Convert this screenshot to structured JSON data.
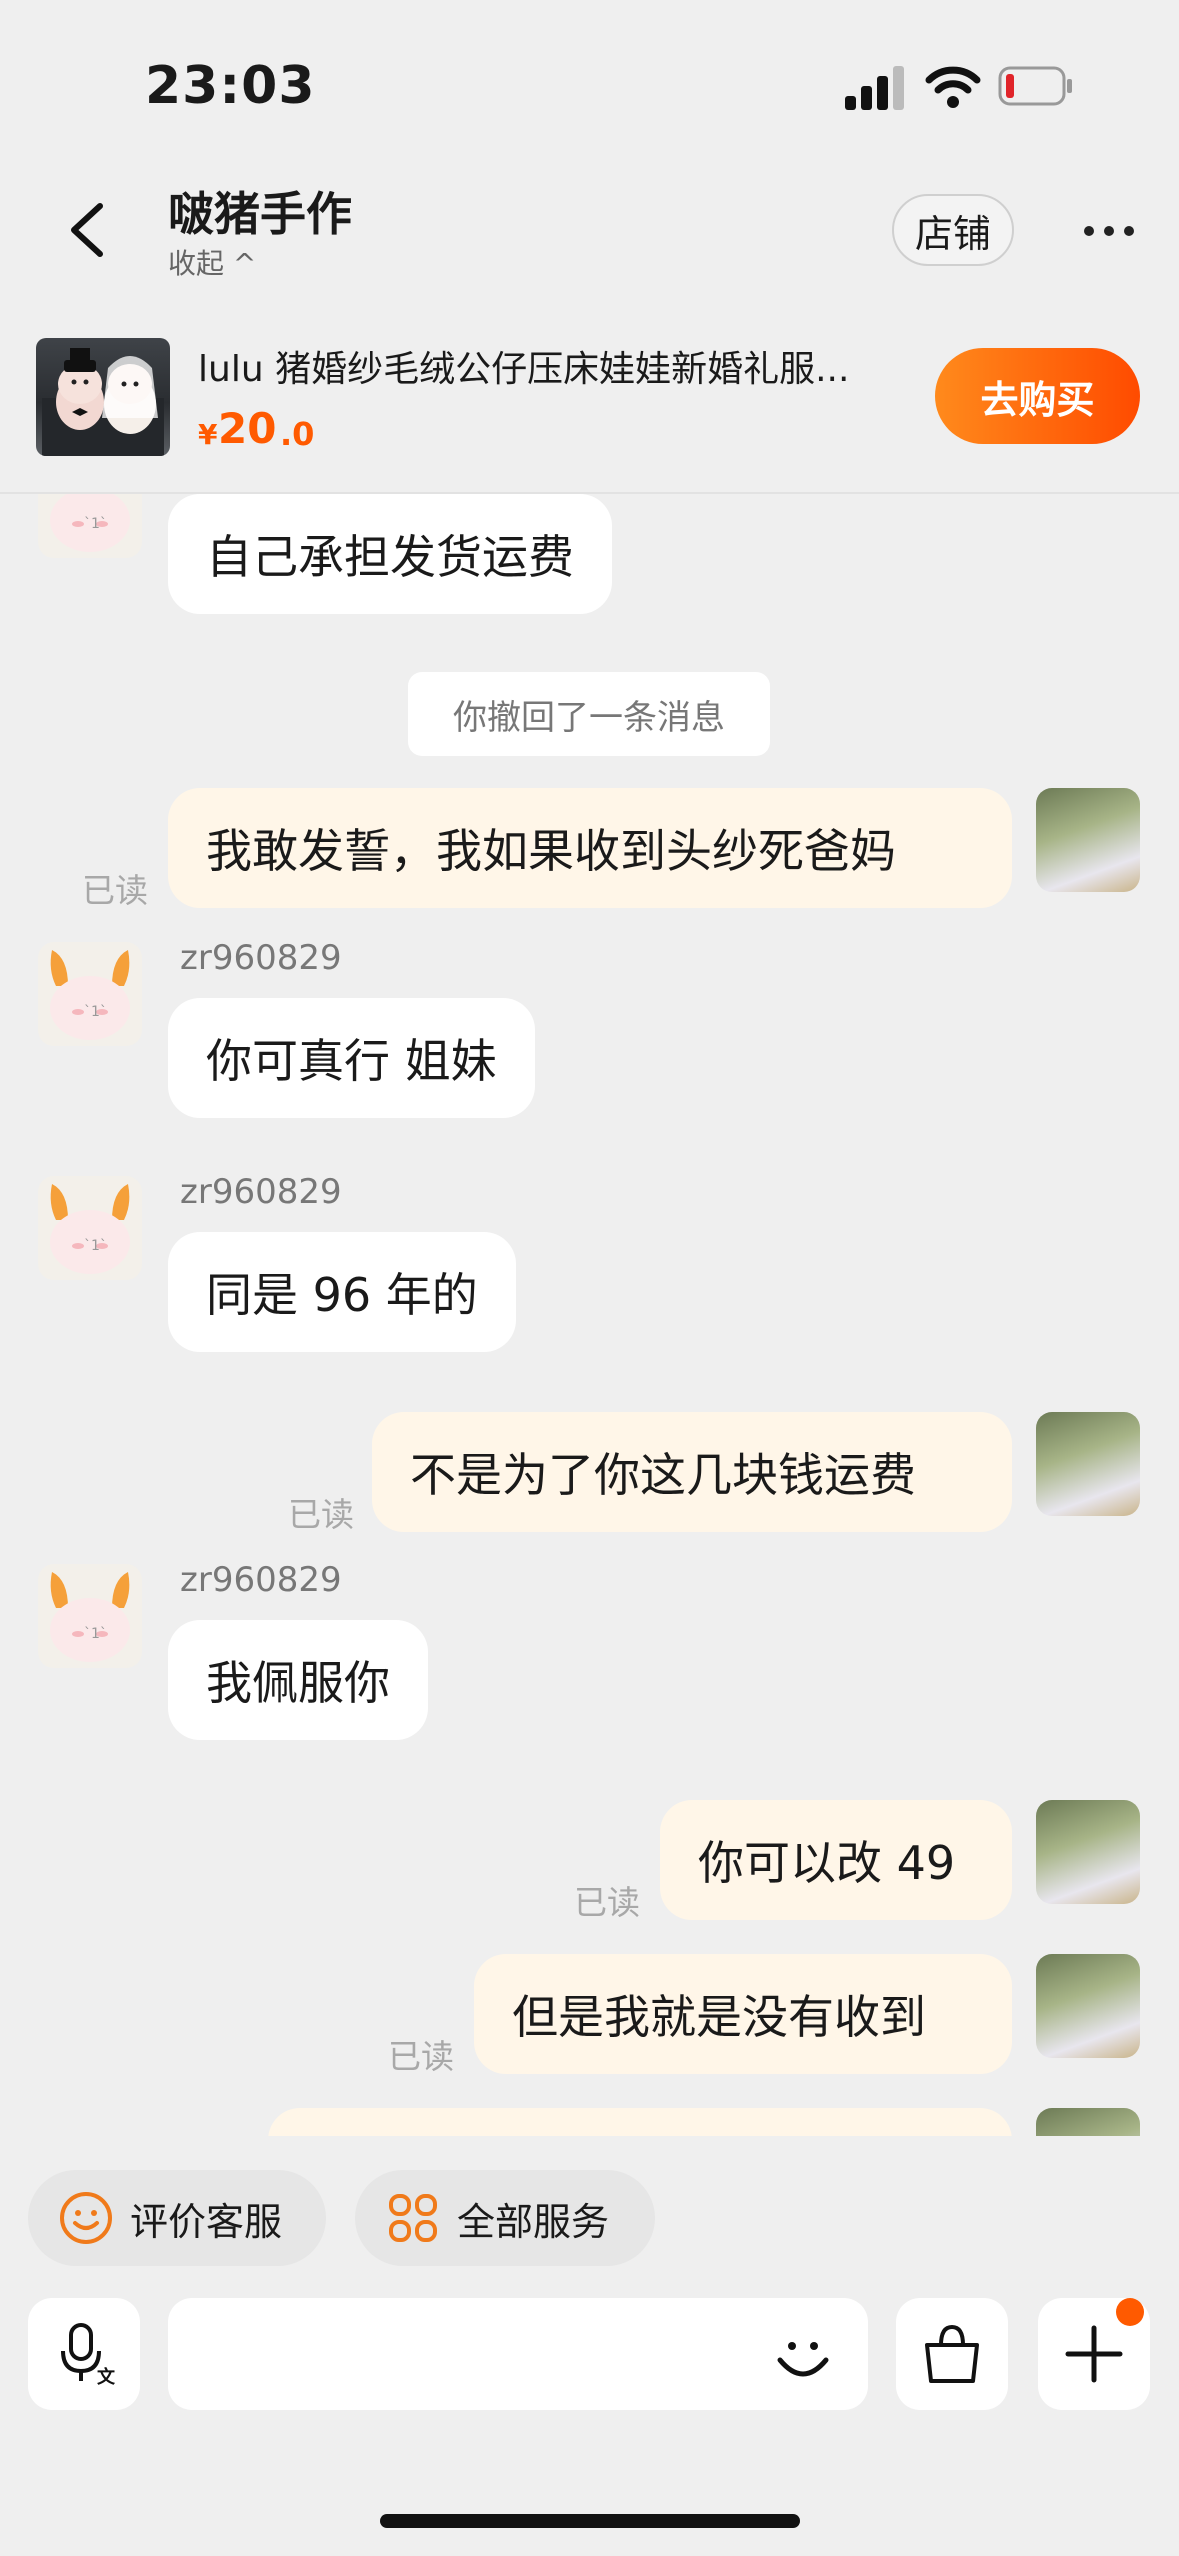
{
  "status_bar": {
    "time": "23:03"
  },
  "header": {
    "title": "啵猪手作",
    "collapse_label": "收起 ^",
    "store_label": "店铺"
  },
  "product": {
    "name": "lulu 猪婚纱毛绒公仔压床娃娃新婚礼服...",
    "price_currency": "¥",
    "price_integer": "20",
    "price_decimal": ".0",
    "buy_label": "去购买"
  },
  "chat": {
    "system_notice": "你撤回了一条消息",
    "messages": [
      {
        "from": "other",
        "text": "自己承担发货运费"
      },
      {
        "from": "me",
        "text": "我敢发誓，我如果收到头纱死爸妈",
        "status": "已读"
      },
      {
        "from": "other",
        "sender": "zr960829",
        "text": "你可真行 姐妹"
      },
      {
        "from": "other",
        "sender": "zr960829",
        "text": "同是 96 年的"
      },
      {
        "from": "me",
        "text": "不是为了你这几块钱运费",
        "status": "已读"
      },
      {
        "from": "other",
        "sender": "zr960829",
        "text": "我佩服你"
      },
      {
        "from": "me",
        "text": "你可以改 49",
        "status": "已读"
      },
      {
        "from": "me",
        "text": "但是我就是没有收到",
        "status": "已读"
      }
    ]
  },
  "quick_actions": [
    {
      "label": "评价客服",
      "icon": "smile-icon"
    },
    {
      "label": "全部服务",
      "icon": "grid-icon"
    }
  ],
  "input_bar": {
    "voice_icon": "mic-icon",
    "emoji_icon": "smile-icon",
    "bag_icon": "shopping-bag-icon",
    "add_icon": "plus-icon"
  },
  "colors": {
    "accent": "#ff5a00",
    "out_bubble": "#fff6e8",
    "background": "#efefef"
  }
}
